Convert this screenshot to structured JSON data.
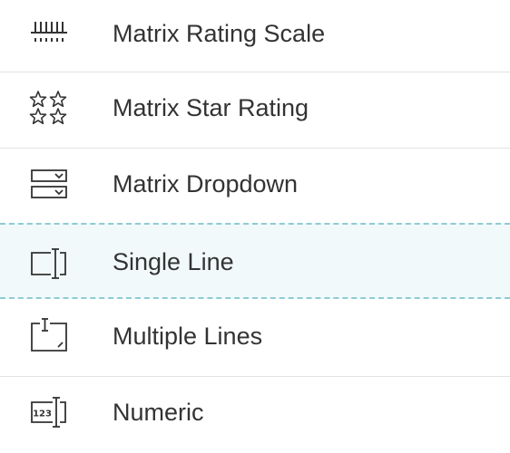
{
  "question_types": [
    {
      "label": "Matrix Rating Scale",
      "icon": "rating-scale-icon"
    },
    {
      "label": "Matrix Star Rating",
      "icon": "star-rating-icon"
    },
    {
      "label": "Matrix Dropdown",
      "icon": "dropdown-icon"
    },
    {
      "label": "Single Line",
      "icon": "single-line-icon",
      "state": "hover"
    },
    {
      "label": "Multiple Lines",
      "icon": "multiple-lines-icon"
    },
    {
      "label": "Numeric",
      "icon": "numeric-icon",
      "icon_text": "123"
    }
  ],
  "colors": {
    "text": "#333333",
    "icon": "#333333",
    "divider": "#e2e2e2",
    "hover_background": "#f1f9fa",
    "hover_border": "#8ecbd3"
  }
}
